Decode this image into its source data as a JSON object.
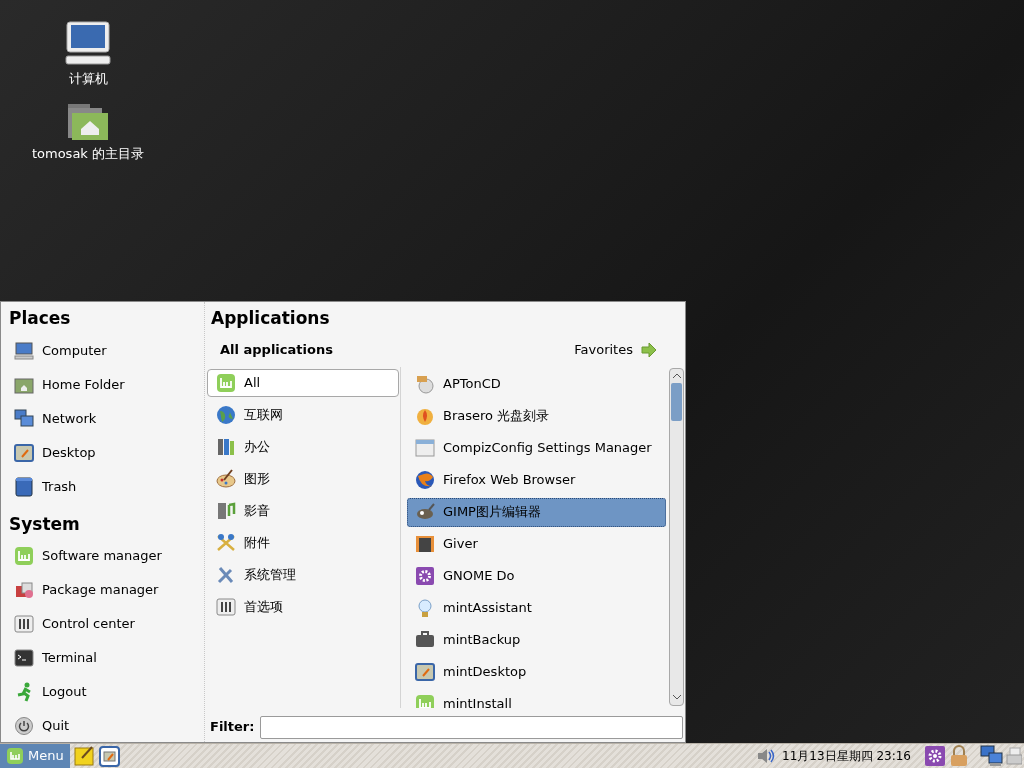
{
  "desktop_icons": [
    {
      "label": "计算机"
    },
    {
      "label": "tomosak 的主目录"
    }
  ],
  "menu": {
    "places": {
      "title": "Places",
      "items": [
        {
          "label": "Computer"
        },
        {
          "label": "Home Folder"
        },
        {
          "label": "Network"
        },
        {
          "label": "Desktop"
        },
        {
          "label": "Trash"
        }
      ]
    },
    "system": {
      "title": "System",
      "items": [
        {
          "label": "Software manager"
        },
        {
          "label": "Package manager"
        },
        {
          "label": "Control center"
        },
        {
          "label": "Terminal"
        },
        {
          "label": "Logout"
        },
        {
          "label": "Quit"
        }
      ]
    },
    "applications": {
      "title": "Applications",
      "subtitle": "All applications",
      "favorites_button": "Favorites",
      "categories": [
        {
          "label": "All",
          "selected": true
        },
        {
          "label": "互联网",
          "selected": false
        },
        {
          "label": "办公",
          "selected": false
        },
        {
          "label": "图形",
          "selected": false
        },
        {
          "label": "影音",
          "selected": false
        },
        {
          "label": "附件",
          "selected": false
        },
        {
          "label": "系统管理",
          "selected": false
        },
        {
          "label": "首选项",
          "selected": false
        }
      ],
      "apps": [
        {
          "label": "APTonCD",
          "selected": false
        },
        {
          "label": "Brasero 光盘刻录",
          "selected": false
        },
        {
          "label": "CompizConfig Settings Manager",
          "selected": false
        },
        {
          "label": "Firefox Web Browser",
          "selected": false
        },
        {
          "label": "GIMP图片编辑器",
          "selected": true
        },
        {
          "label": "Giver",
          "selected": false
        },
        {
          "label": "GNOME Do",
          "selected": false
        },
        {
          "label": "mintAssistant",
          "selected": false
        },
        {
          "label": "mintBackup",
          "selected": false
        },
        {
          "label": "mintDesktop",
          "selected": false
        },
        {
          "label": "mintInstall",
          "selected": false
        }
      ]
    },
    "filter": {
      "label": "Filter:"
    }
  },
  "taskbar": {
    "menu_button": "Menu",
    "clock": "11月13日星期四 23:16"
  }
}
